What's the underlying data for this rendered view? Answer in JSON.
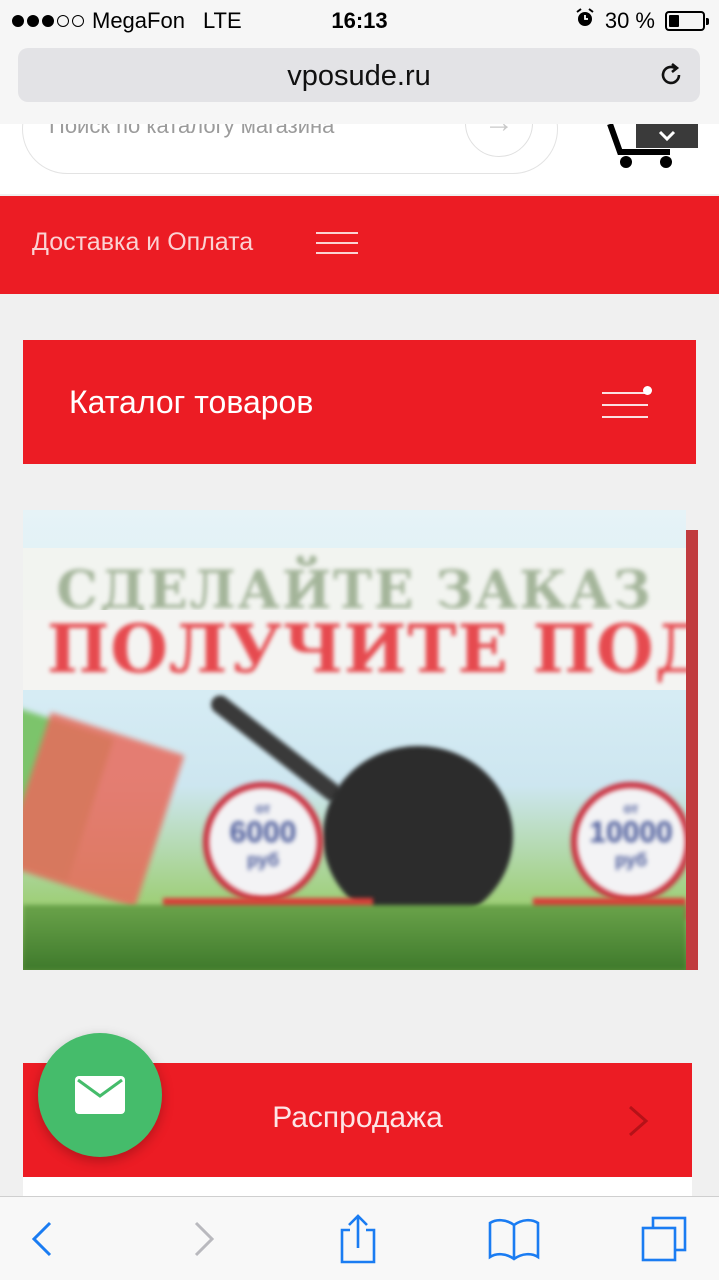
{
  "status_bar": {
    "carrier": "MegaFon",
    "network": "LTE",
    "time": "16:13",
    "battery_text": "30 %",
    "battery_level": 0.3,
    "signal_bars": 3,
    "signal_total": 5
  },
  "browser": {
    "url": "vposude.ru",
    "reload_icon": "reload-icon"
  },
  "search": {
    "placeholder": "Поиск по каталогу магазина"
  },
  "nav": {
    "delivery_link": "Доставка и Оплата"
  },
  "catalog": {
    "title": "Каталог товаров"
  },
  "banner": {
    "line1": "СДЕЛАЙТЕ ЗАКАЗ",
    "line2": "ПОЛУЧИТЕ ПОДАРОК",
    "badge1_top": "от",
    "badge1_value": "6000",
    "badge1_unit": "руб",
    "badge2_top": "от",
    "badge2_value": "10000",
    "badge2_unit": "руб"
  },
  "sale": {
    "title": "Распродажа"
  },
  "colors": {
    "brand_red": "#ec1c24",
    "fab_green": "#45bc6b",
    "ios_blue": "#1a7cf2"
  },
  "toolbar": {
    "back": "back-icon",
    "forward": "forward-icon",
    "share": "share-icon",
    "bookmarks": "bookmarks-icon",
    "tabs": "tabs-icon"
  }
}
